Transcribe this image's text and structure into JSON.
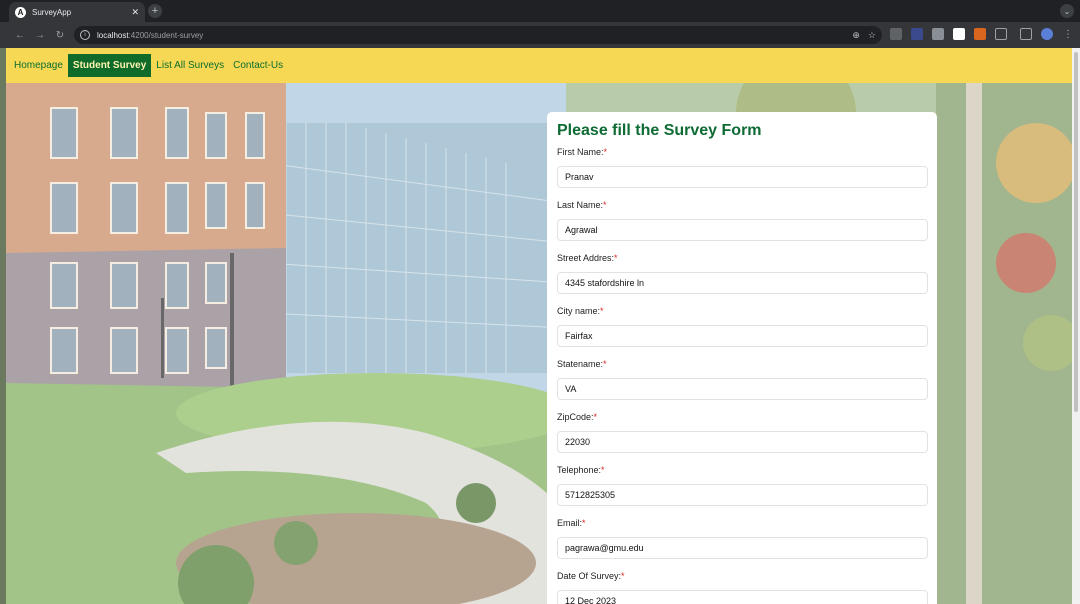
{
  "browser": {
    "tab_title": "SurveyApp",
    "tab_favicon_letter": "A",
    "url_host": "localhost",
    "url_path": ":4200/student-survey"
  },
  "nav": {
    "items": [
      {
        "label": "Homepage",
        "active": false
      },
      {
        "label": "Student Survey",
        "active": true
      },
      {
        "label": "List All Surveys",
        "active": false
      },
      {
        "label": "Contact-Us",
        "active": false
      }
    ]
  },
  "form": {
    "title": "Please fill the Survey Form",
    "required_marker": "*",
    "fields": [
      {
        "label": "First Name:",
        "value": "Pranav"
      },
      {
        "label": "Last Name:",
        "value": "Agrawal"
      },
      {
        "label": "Street Addres:",
        "value": "4345 stafordshire ln"
      },
      {
        "label": "City name:",
        "value": "Fairfax"
      },
      {
        "label": "Statename:",
        "value": "VA"
      },
      {
        "label": "ZipCode:",
        "value": "22030"
      },
      {
        "label": "Telephone:",
        "value": "5712825305"
      },
      {
        "label": "Email:",
        "value": "pagrawa@gmu.edu"
      },
      {
        "label": "Date Of Survey:",
        "value": "12 Dec 2023"
      }
    ]
  },
  "colors": {
    "navbar_bg": "#f6d855",
    "nav_active_bg": "#0f6b2a",
    "title_green": "#0e6b34",
    "required_red": "#dd2222"
  }
}
